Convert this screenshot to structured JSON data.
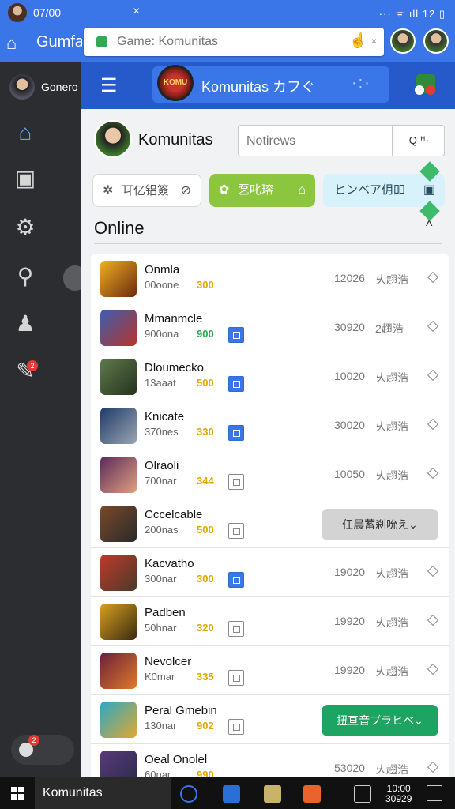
{
  "status": {
    "time": "07/00",
    "close": "×",
    "sys": "··· ᯤ ıll 12 ▯"
  },
  "appbar": {
    "title": "Gumfa",
    "home_icon": "home-icon"
  },
  "browser": {
    "url": "Game: Komunitas",
    "tab_close": "×",
    "hand_icon": "hand-icon"
  },
  "sidebar": {
    "user": "Gonero",
    "items": [
      {
        "icon": "home-icon",
        "glyph": "⌂"
      },
      {
        "icon": "library-icon",
        "glyph": "▣"
      },
      {
        "icon": "gear-icon",
        "glyph": "⚙"
      },
      {
        "icon": "search-icon",
        "glyph": "⚲"
      },
      {
        "icon": "person-icon",
        "glyph": "♟"
      },
      {
        "icon": "rocket-icon",
        "glyph": "✎"
      }
    ],
    "badge": "2"
  },
  "topnav": {
    "brand": "Komunitas カフぐ",
    "logo_text": "KOMU",
    "dots": "·:·"
  },
  "profile": {
    "name": "Komunitas"
  },
  "search": {
    "placeholder": "Notirews",
    "button": "Q ꟸ·"
  },
  "chips": [
    {
      "label": "㔿亿铝簽",
      "icon": "✲",
      "end": "⊘"
    },
    {
      "label": "乭叱瑢",
      "icon": "✿",
      "end": "⌂"
    },
    {
      "label": "ヒンベア仴吅",
      "icon": "",
      "end": "▣"
    }
  ],
  "section": {
    "title": "Online",
    "chevron": "^"
  },
  "rows": [
    {
      "name": "Onmla",
      "sub": "00oone",
      "num": "300",
      "num_color": "#e0a800",
      "box": "none",
      "stat": "12026",
      "stat2": "乆趐浩",
      "action": ""
    },
    {
      "name": "Mmanmcle",
      "sub": "900ona",
      "num": "900",
      "num_color": "#2aa84a",
      "box": "on",
      "stat": "30920",
      "stat2": "2趐浩",
      "action": ""
    },
    {
      "name": "Dloumecko",
      "sub": "13aaat",
      "num": "500",
      "num_color": "#e0a800",
      "box": "on",
      "stat": "10020",
      "stat2": "乆趐浩",
      "action": ""
    },
    {
      "name": "Knicate",
      "sub": "370nes",
      "num": "330",
      "num_color": "#e0a800",
      "box": "on",
      "stat": "30020",
      "stat2": "乆趐浩",
      "action": ""
    },
    {
      "name": "Olraoli",
      "sub": "700nar",
      "num": "344",
      "num_color": "#e0a800",
      "box": "off",
      "stat": "10050",
      "stat2": "乆趐浩",
      "action": ""
    },
    {
      "name": "Cccelcable",
      "sub": "200nas",
      "num": "500",
      "num_color": "#e0a800",
      "box": "off",
      "stat": "",
      "stat2": "",
      "action": "仜晨蓄刹吮え⌄"
    },
    {
      "name": "Kacvatho",
      "sub": "300nar",
      "num": "300",
      "num_color": "#e0a800",
      "box": "on",
      "stat": "19020",
      "stat2": "乆趐浩",
      "action": ""
    },
    {
      "name": "Padben",
      "sub": "50hnar",
      "num": "320",
      "num_color": "#e0a800",
      "box": "off",
      "stat": "19920",
      "stat2": "乆趐浩",
      "action": ""
    },
    {
      "name": "Nevolcer",
      "sub": "K0mar",
      "num": "335",
      "num_color": "#e0a800",
      "box": "off",
      "stat": "19920",
      "stat2": "乆趐浩",
      "action": ""
    },
    {
      "name": "Peral Gmebin",
      "sub": "130nar",
      "num": "902",
      "num_color": "#e0a800",
      "box": "off",
      "stat": "",
      "stat2": "",
      "action": "扭亘音ブラヒベ⌄"
    },
    {
      "name": "Oeal Onolel",
      "sub": "60nar",
      "num": "990",
      "num_color": "#e0a800",
      "box": "none",
      "stat": "53020",
      "stat2": "乆趐浩",
      "action": ""
    }
  ],
  "taskbar": {
    "label": "Komunitas",
    "clock_time": "10:00",
    "clock_date": "30929"
  },
  "colors": {
    "accent": "#3a76e8",
    "nav": "#2659c9",
    "green": "#8cc63f",
    "action_green": "#1ea462"
  }
}
